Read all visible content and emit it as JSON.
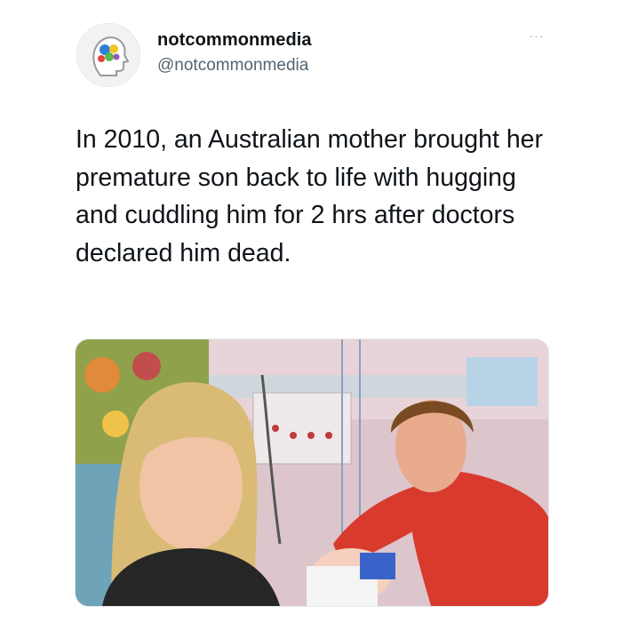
{
  "tweet": {
    "author": {
      "display_name": "notcommonmedia",
      "handle": "@notcommonmedia",
      "avatar_icon": "head-profile-colorful-dots-logo"
    },
    "more_icon": "more-options-dots-icon",
    "more_label": "···",
    "text": "In 2010, an Australian mother brought her premature son back to life with hugging and cuddling him for 2 hrs after doctors declared him dead."
  },
  "colors": {
    "text_primary": "#0f1419",
    "text_secondary": "#536471",
    "background": "#ffffff"
  }
}
